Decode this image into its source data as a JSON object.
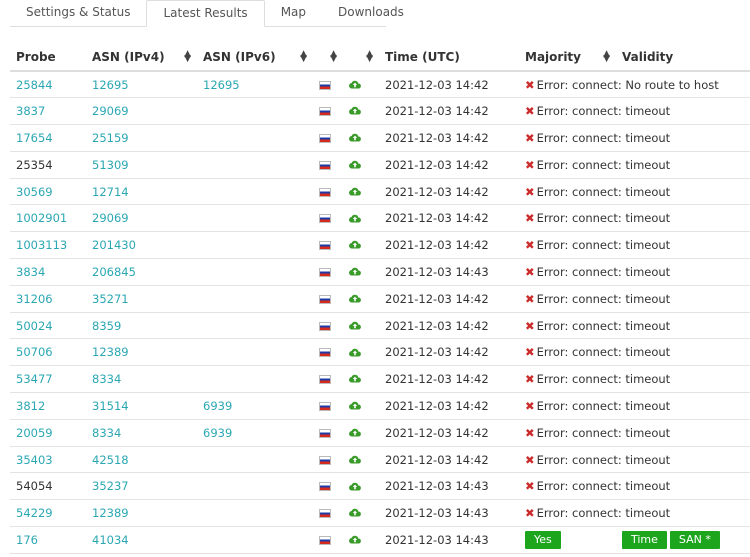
{
  "tabs": [
    {
      "label": "Settings & Status"
    },
    {
      "label": "Latest Results"
    },
    {
      "label": "Map"
    },
    {
      "label": "Downloads"
    }
  ],
  "columns": {
    "probe": "Probe",
    "asn4": "ASN (IPv4)",
    "asn6": "ASN (IPv6)",
    "time": "Time (UTC)",
    "majority": "Majority",
    "validity": "Validity"
  },
  "icons": {
    "flag": "russia-flag-icon",
    "cloud": "cloud-upload-icon",
    "error": "error-x-icon",
    "sort": "sort-arrows-icon"
  },
  "colors": {
    "link": "#2aa7b3",
    "badge": "#1ea51e",
    "error": "#cc2b2b"
  },
  "rows": [
    {
      "probe": "25844",
      "probe_link": true,
      "asn4": "12695",
      "asn6": "12695",
      "time": "2021-12-03 14:42",
      "result": "Error: connect: No route to host"
    },
    {
      "probe": "3837",
      "probe_link": true,
      "asn4": "29069",
      "asn6": "",
      "time": "2021-12-03 14:42",
      "result": "Error: connect: timeout"
    },
    {
      "probe": "17654",
      "probe_link": true,
      "asn4": "25159",
      "asn6": "",
      "time": "2021-12-03 14:42",
      "result": "Error: connect: timeout"
    },
    {
      "probe": "25354",
      "probe_link": false,
      "asn4": "51309",
      "asn6": "",
      "time": "2021-12-03 14:42",
      "result": "Error: connect: timeout"
    },
    {
      "probe": "30569",
      "probe_link": true,
      "asn4": "12714",
      "asn6": "",
      "time": "2021-12-03 14:42",
      "result": "Error: connect: timeout"
    },
    {
      "probe": "1002901",
      "probe_link": true,
      "asn4": "29069",
      "asn6": "",
      "time": "2021-12-03 14:42",
      "result": "Error: connect: timeout"
    },
    {
      "probe": "1003113",
      "probe_link": true,
      "asn4": "201430",
      "asn6": "",
      "time": "2021-12-03 14:42",
      "result": "Error: connect: timeout"
    },
    {
      "probe": "3834",
      "probe_link": true,
      "asn4": "206845",
      "asn6": "",
      "time": "2021-12-03 14:43",
      "result": "Error: connect: timeout"
    },
    {
      "probe": "31206",
      "probe_link": true,
      "asn4": "35271",
      "asn6": "",
      "time": "2021-12-03 14:42",
      "result": "Error: connect: timeout"
    },
    {
      "probe": "50024",
      "probe_link": true,
      "asn4": "8359",
      "asn6": "",
      "time": "2021-12-03 14:42",
      "result": "Error: connect: timeout"
    },
    {
      "probe": "50706",
      "probe_link": true,
      "asn4": "12389",
      "asn6": "",
      "time": "2021-12-03 14:42",
      "result": "Error: connect: timeout"
    },
    {
      "probe": "53477",
      "probe_link": true,
      "asn4": "8334",
      "asn6": "",
      "time": "2021-12-03 14:42",
      "result": "Error: connect: timeout"
    },
    {
      "probe": "3812",
      "probe_link": true,
      "asn4": "31514",
      "asn6": "6939",
      "time": "2021-12-03 14:42",
      "result": "Error: connect: timeout"
    },
    {
      "probe": "20059",
      "probe_link": true,
      "asn4": "8334",
      "asn6": "6939",
      "time": "2021-12-03 14:42",
      "result": "Error: connect: timeout"
    },
    {
      "probe": "35403",
      "probe_link": true,
      "asn4": "42518",
      "asn6": "",
      "time": "2021-12-03 14:42",
      "result": "Error: connect: timeout"
    },
    {
      "probe": "54054",
      "probe_link": false,
      "asn4": "35237",
      "asn6": "",
      "time": "2021-12-03 14:43",
      "result": "Error: connect: timeout"
    },
    {
      "probe": "54229",
      "probe_link": true,
      "asn4": "12389",
      "asn6": "",
      "time": "2021-12-03 14:43",
      "result": "Error: connect: timeout"
    },
    {
      "probe": "176",
      "probe_link": true,
      "asn4": "41034",
      "asn6": "",
      "time": "2021-12-03 14:43",
      "result": "",
      "majority_badge": "Yes",
      "validity_badges": [
        "Time",
        "SAN *"
      ]
    }
  ]
}
